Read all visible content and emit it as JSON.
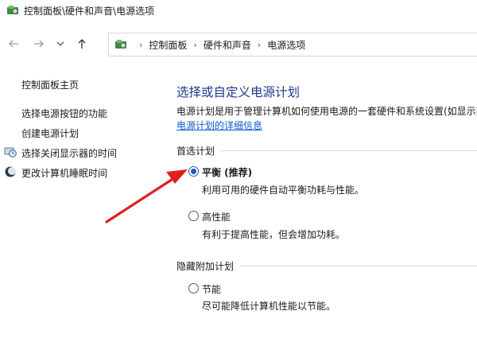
{
  "window": {
    "title": "控制面板\\硬件和声音\\电源选项",
    "app_icon": "control-panel-icon"
  },
  "navigation": {
    "back_icon": "arrow-left-icon",
    "forward_icon": "arrow-right-icon",
    "recent_icon": "chevron-down-icon",
    "up_icon": "arrow-up-icon",
    "breadcrumb": [
      "控制面板",
      "硬件和声音",
      "电源选项"
    ]
  },
  "sidebar": {
    "home": "控制面板主页",
    "items": [
      {
        "label": "选择电源按钮的功能",
        "icon": null
      },
      {
        "label": "创建电源计划",
        "icon": null
      },
      {
        "label": "选择关闭显示器的时间",
        "icon": "monitor-clock-icon"
      },
      {
        "label": "更改计算机睡眠时间",
        "icon": "moon-icon"
      }
    ]
  },
  "main": {
    "title": "选择或自定义电源计划",
    "description": "电源计划是用于管理计算机如何使用电源的一套硬件和系统设置(如显示亮",
    "detail_link": "电源计划的详细信息",
    "preferred_heading": "首选计划",
    "hidden_heading": "隐藏附加计划",
    "plans": [
      {
        "name": "平衡 (推荐)",
        "desc": "利用可用的硬件自动平衡功耗与性能。",
        "selected": true
      },
      {
        "name": "高性能",
        "desc": "有利于提高性能，但会增加功耗。",
        "selected": false
      },
      {
        "name": "节能",
        "desc": "尽可能降低计算机性能以节能。",
        "selected": false
      }
    ]
  },
  "colors": {
    "title_blue": "#1e3a8a",
    "link_blue": "#0a5ad4",
    "annotation_red": "#e01e1e"
  }
}
